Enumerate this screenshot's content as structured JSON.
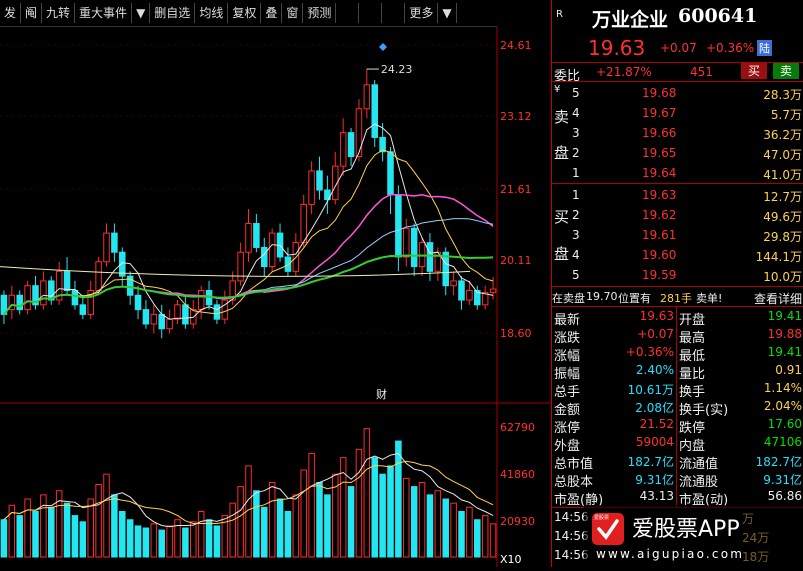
{
  "toolbar": {
    "buttons": [
      "发",
      "阄",
      "九转",
      "重大事件",
      "▼",
      "删自选",
      "均线",
      "复权",
      "叠",
      "窗",
      "预测",
      "",
      "",
      "",
      "更多",
      "▼"
    ]
  },
  "chart": {
    "price_ticks": [
      "24.61",
      "23.12",
      "21.61",
      "20.11",
      "18.60"
    ],
    "volume_ticks": [
      "62790",
      "41860",
      "20930",
      "X10"
    ],
    "high_label": "24.23",
    "event_marker": "财",
    "colors": {
      "up": "#ff2b2b",
      "down": "#23e6f0",
      "ma5": "#e8e8e8",
      "ma10": "#ffd24a",
      "ma20": "#ff55d8",
      "ma60": "#33cc33",
      "ma_long": "#99ccff",
      "ma120": "#eeeeaa"
    }
  },
  "quote": {
    "r_label": "R",
    "name": "万业企业",
    "code": "600641",
    "price": "19.63",
    "change": "+0.07",
    "change_pct": "+0.36%",
    "market_tag": "陆",
    "weibi_label": "委比",
    "weibi_value": "+21.87%",
    "weicha_value": "451",
    "buy_btn": "买",
    "sell_btn": "卖",
    "sell_label": [
      "卖",
      "盘"
    ],
    "buy_label": [
      "买",
      "盘"
    ],
    "yen": "¥",
    "asks": [
      {
        "lvl": "5",
        "price": "19.68",
        "vol": "28.3万"
      },
      {
        "lvl": "4",
        "price": "19.67",
        "vol": "5.7万"
      },
      {
        "lvl": "3",
        "price": "19.66",
        "vol": "36.2万"
      },
      {
        "lvl": "2",
        "price": "19.65",
        "vol": "47.0万"
      },
      {
        "lvl": "1",
        "price": "19.64",
        "vol": "41.0万"
      }
    ],
    "bids": [
      {
        "lvl": "1",
        "price": "19.63",
        "vol": "12.7万"
      },
      {
        "lvl": "2",
        "price": "19.62",
        "vol": "49.6万"
      },
      {
        "lvl": "3",
        "price": "19.61",
        "vol": "29.8万"
      },
      {
        "lvl": "4",
        "price": "19.60",
        "vol": "144.1万"
      },
      {
        "lvl": "5",
        "price": "19.59",
        "vol": "10.0万"
      }
    ],
    "sell_notice": {
      "prefix": "在卖盘",
      "price": "19.70",
      "mid": "位置有",
      "qty": "281手",
      "suffix": "卖单!"
    },
    "detail_link": "查看详细",
    "stats_left": [
      {
        "k": "最新",
        "v": "19.63",
        "c": "red"
      },
      {
        "k": "涨跌",
        "v": "+0.07",
        "c": "red"
      },
      {
        "k": "涨幅",
        "v": "+0.36%",
        "c": "red"
      },
      {
        "k": "振幅",
        "v": "2.40%",
        "c": "cyan"
      },
      {
        "k": "总手",
        "v": "10.61万",
        "c": "cyan"
      },
      {
        "k": "金额",
        "v": "2.08亿",
        "c": "cyan"
      },
      {
        "k": "涨停",
        "v": "21.52",
        "c": "red"
      },
      {
        "k": "外盘",
        "v": "59004",
        "c": "red"
      },
      {
        "k": "总市值",
        "v": "182.7亿",
        "c": "cyan"
      },
      {
        "k": "总股本",
        "v": "9.31亿",
        "c": "cyan"
      },
      {
        "k": "市盈(静)",
        "v": "43.13",
        "c": "white"
      }
    ],
    "stats_right": [
      {
        "k": "开盘",
        "v": "19.41",
        "c": "green"
      },
      {
        "k": "最高",
        "v": "19.88",
        "c": "red"
      },
      {
        "k": "最低",
        "v": "19.41",
        "c": "green"
      },
      {
        "k": "量比",
        "v": "0.91",
        "c": "yellow"
      },
      {
        "k": "换手",
        "v": "1.14%",
        "c": "yellow"
      },
      {
        "k": "换手(实)",
        "v": "2.04%",
        "c": "yellow"
      },
      {
        "k": "跌停",
        "v": "17.60",
        "c": "green"
      },
      {
        "k": "内盘",
        "v": "47106",
        "c": "green"
      },
      {
        "k": "流通值",
        "v": "182.7亿",
        "c": "cyan"
      },
      {
        "k": "流通股",
        "v": "9.31亿",
        "c": "cyan"
      },
      {
        "k": "市盈(动)",
        "v": "56.86",
        "c": "white"
      }
    ],
    "ticks": [
      {
        "t": "14:56",
        "tail": "万"
      },
      {
        "t": "14:56",
        "tail": "24万"
      },
      {
        "t": "14:56",
        "tail": "18万"
      }
    ]
  },
  "watermark": {
    "brand": "爱股票APP",
    "url": "www.aigupiao.com",
    "logo": "爱股票"
  }
}
